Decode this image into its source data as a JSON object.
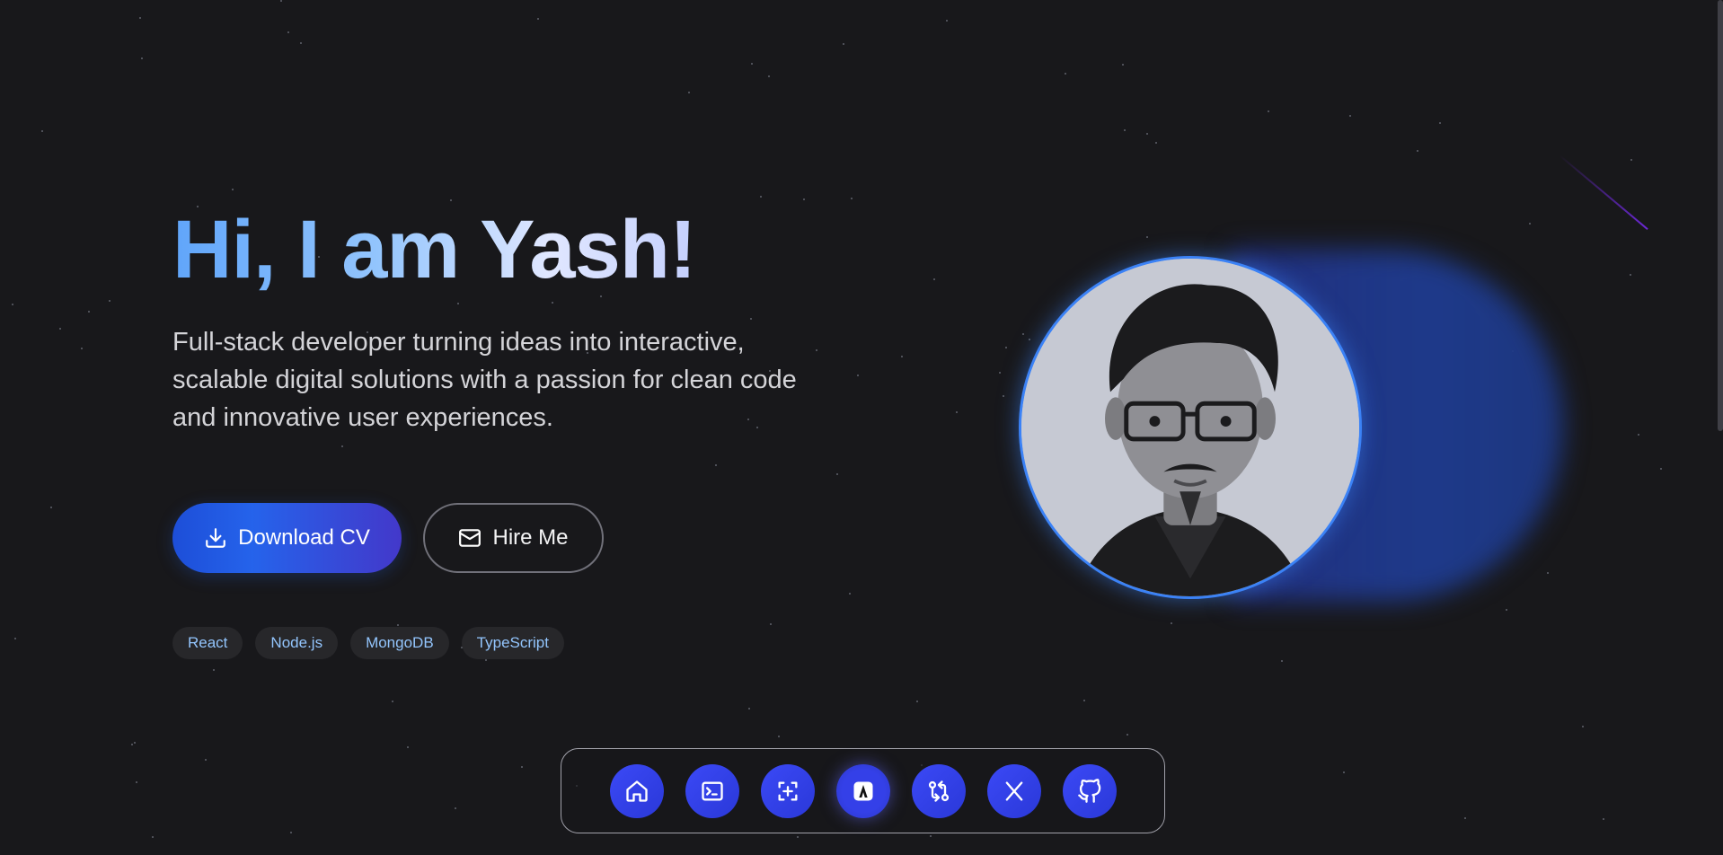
{
  "hero": {
    "title": "Hi, I am Yash!",
    "subtitle": "Full-stack developer turning ideas into interactive, scalable digital solutions with a passion for clean code and innovative user experiences.",
    "download_label": "Download CV",
    "hire_label": "Hire Me",
    "tags": [
      "React",
      "Node.js",
      "MongoDB",
      "TypeScript"
    ]
  },
  "icons": {
    "download": "download-icon",
    "mail": "mail-icon",
    "profile_photo": "profile-photo"
  },
  "dock": {
    "items": [
      {
        "icon": "home-icon"
      },
      {
        "icon": "terminal-icon"
      },
      {
        "icon": "add-frame-icon"
      },
      {
        "icon": "logo-icon",
        "active": true
      },
      {
        "icon": "git-compare-icon"
      },
      {
        "icon": "x-twitter-icon"
      },
      {
        "icon": "github-icon"
      }
    ]
  },
  "colors": {
    "background": "#18181b",
    "accent": "#2563eb",
    "tag_text": "#93c5fd"
  }
}
